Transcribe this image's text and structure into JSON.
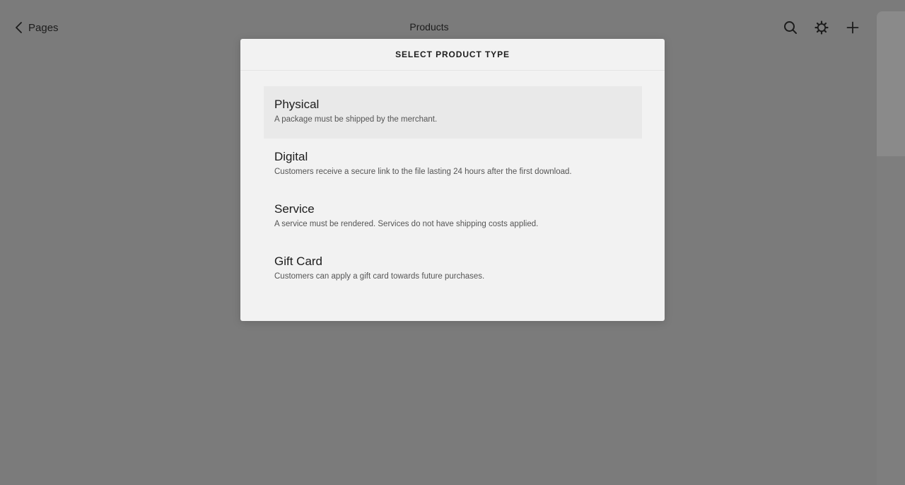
{
  "header": {
    "back_label": "Pages",
    "title": "Products"
  },
  "icons": {
    "back": "chevron-left-icon",
    "search": "search-icon",
    "settings": "gear-icon",
    "add": "plus-icon"
  },
  "modal": {
    "title": "SELECT PRODUCT TYPE",
    "options": [
      {
        "title": "Physical",
        "description": "A package must be shipped by the merchant."
      },
      {
        "title": "Digital",
        "description": "Customers receive a secure link to the file lasting 24 hours after the first download."
      },
      {
        "title": "Service",
        "description": "A service must be rendered. Services do not have shipping costs applied."
      },
      {
        "title": "Gift Card",
        "description": "Customers can apply a gift card towards future purchases."
      }
    ],
    "selected_index": 0
  },
  "colors": {
    "overlay": "#7b7b7b",
    "modal_bg": "#f2f2f2",
    "selected_bg": "#e9e9e9",
    "text": "#1c1c1c"
  }
}
